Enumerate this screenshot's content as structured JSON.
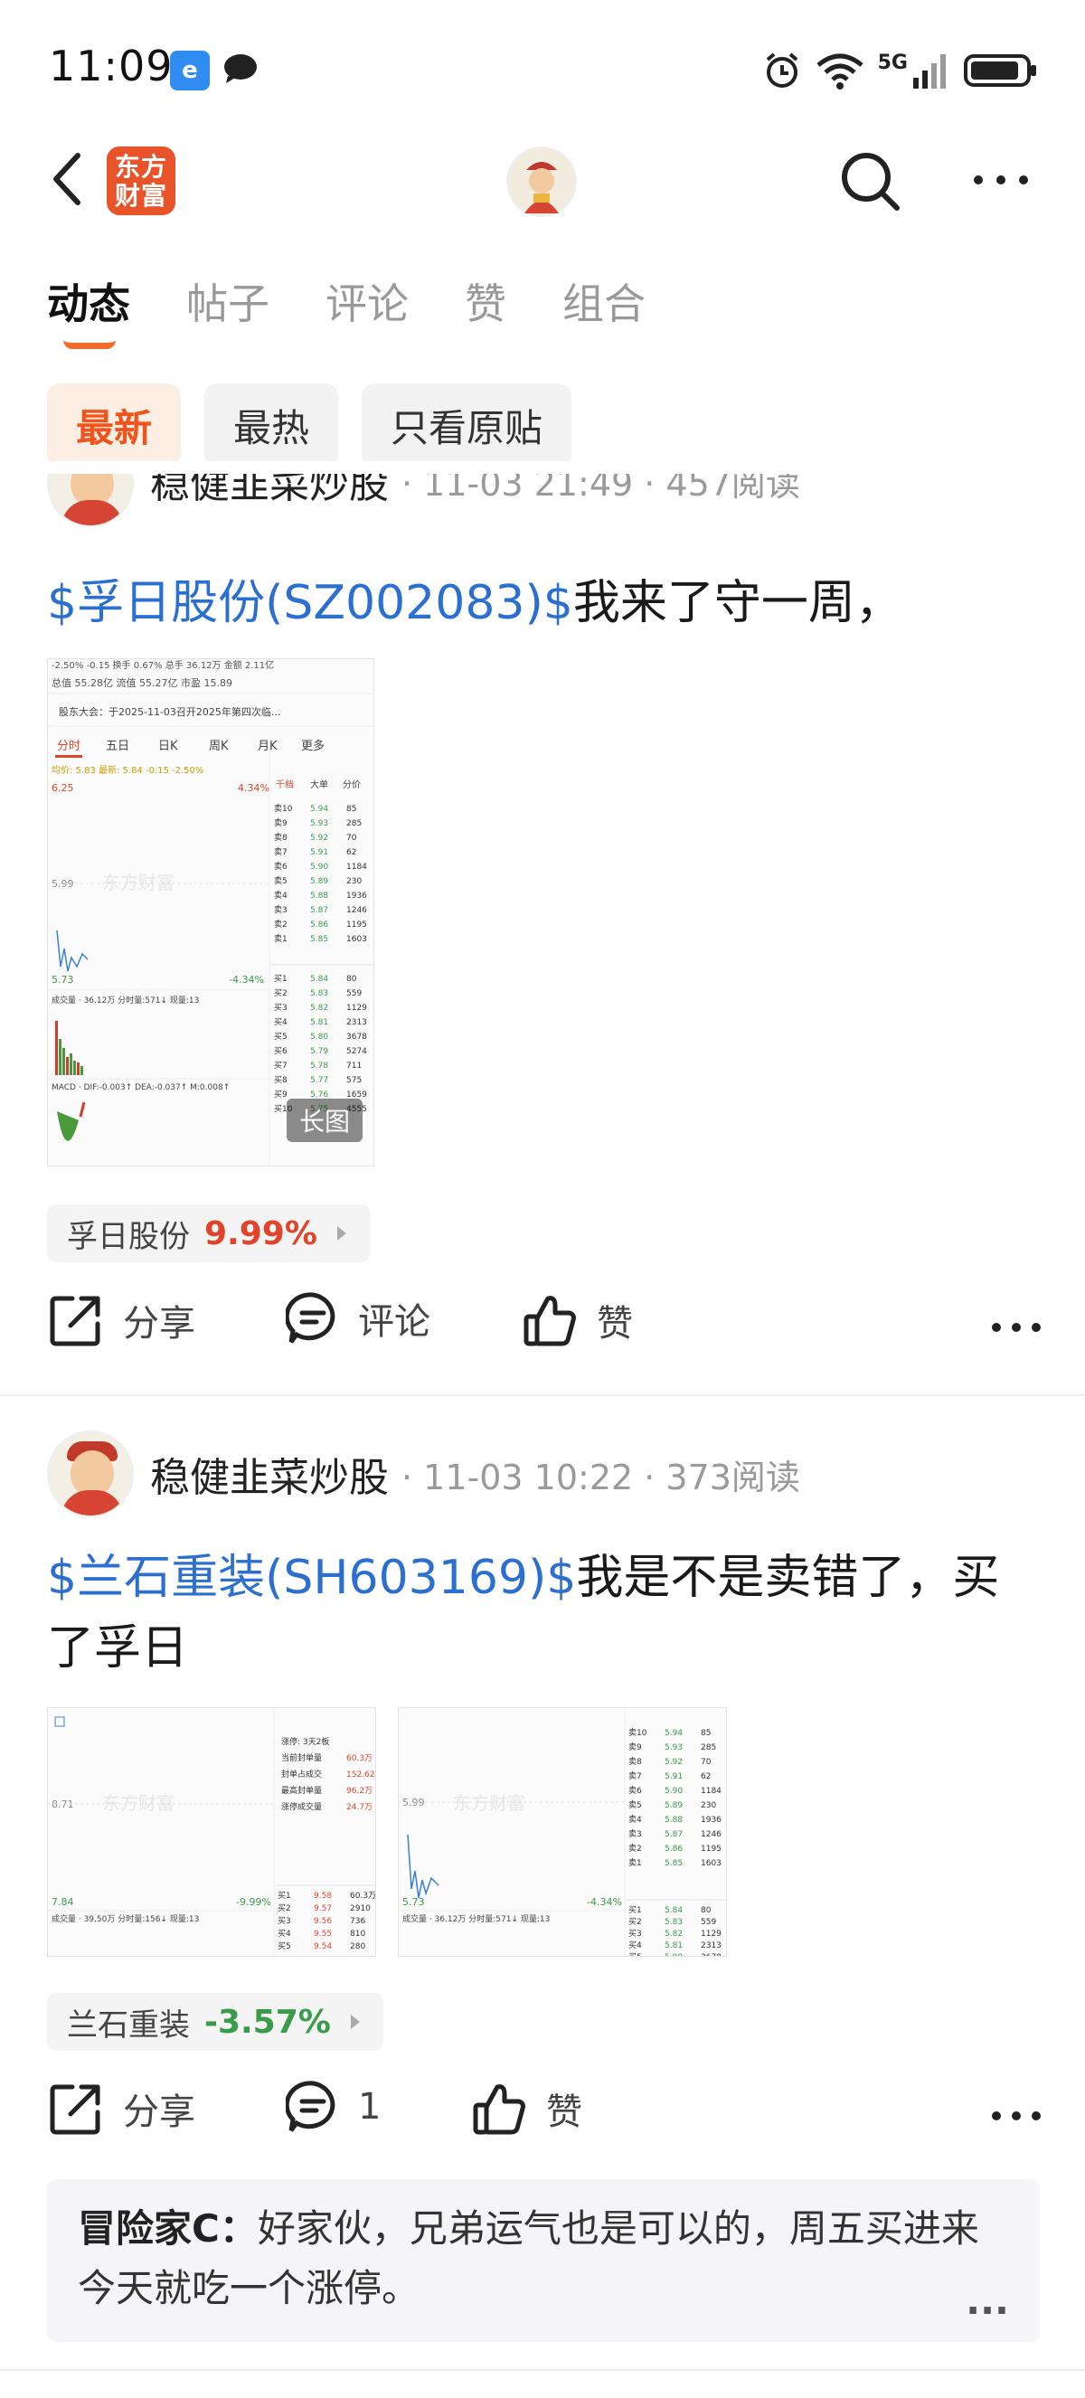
{
  "status_bar": {
    "time": "11:09",
    "network": "5G"
  },
  "header": {
    "logo_text": "东方财富"
  },
  "tabs": [
    {
      "label": "动态"
    },
    {
      "label": "帖子"
    },
    {
      "label": "评论"
    },
    {
      "label": "赞"
    },
    {
      "label": "组合"
    }
  ],
  "filters": [
    {
      "label": "最新"
    },
    {
      "label": "最热"
    },
    {
      "label": "只看原贴"
    }
  ],
  "posts": [
    {
      "username": "稳健韭菜炒股",
      "meta": "· 11-03 21:49 · 457阅读",
      "stock_link": "$孚日股份(SZ002083)$",
      "text": "我来了守一周，",
      "image_badge": "长图",
      "tag_name": "孚日股份",
      "tag_pct": "9.99%",
      "tag_color": "#e0452b",
      "share": "分享",
      "comment": "评论",
      "like": "赞"
    },
    {
      "username": "稳健韭菜炒股",
      "meta": "· 11-03 10:22 · 373阅读",
      "stock_link": "$兰石重装(SH603169)$",
      "text": "我是不是卖错了，买了孚日",
      "tag_name": "兰石重装",
      "tag_pct": "-3.57%",
      "tag_color": "#3a9b4a",
      "share": "分享",
      "comment": "1",
      "like": "赞"
    }
  ],
  "comment": {
    "author": "冒险家C：",
    "text": "好家伙，兄弟运气也是可以的，周五买进来今天就吃一个涨停。",
    "more": "..."
  },
  "chart1": {
    "top_row": "-2.50%  -0.15  换手 0.67%  总手 36.12万  金额 2.11亿",
    "row2": "总值 55.28亿   流值 55.27亿   市盈 15.89",
    "notice": "股东大会：于2025-11-03召开2025年第四次临...",
    "tabs": [
      "分时",
      "五日",
      "日K",
      "周K",
      "月K",
      "更多"
    ],
    "avg_line": "均价: 5.83  最新: 5.84  -0.15  -2.50%",
    "price_hi": "6.25",
    "pct_hi": "4.34%",
    "price_mid": "5.99",
    "price_lo": "5.73",
    "pct_lo": "-4.34%",
    "vol": "成交量 · 36.12万    分时量:571↓    现量:13",
    "macd": "MACD · DIF:-0.003↑  DEA:-0.037↑  M:0.008↑",
    "tabs_right": [
      "千档",
      "大单",
      "分价"
    ],
    "sells": [
      [
        "卖10",
        "5.94",
        "85"
      ],
      [
        "卖9",
        "5.93",
        "285"
      ],
      [
        "卖8",
        "5.92",
        "70"
      ],
      [
        "卖7",
        "5.91",
        "62"
      ],
      [
        "卖6",
        "5.90",
        "1184"
      ],
      [
        "卖5",
        "5.89",
        "230"
      ],
      [
        "卖4",
        "5.88",
        "1936"
      ],
      [
        "卖3",
        "5.87",
        "1246"
      ],
      [
        "卖2",
        "5.86",
        "1195"
      ],
      [
        "卖1",
        "5.85",
        "1603"
      ]
    ],
    "buys": [
      [
        "买1",
        "5.84",
        "80"
      ],
      [
        "买2",
        "5.83",
        "559"
      ],
      [
        "买3",
        "5.82",
        "1129"
      ],
      [
        "买4",
        "5.81",
        "2313"
      ],
      [
        "买5",
        "5.80",
        "3678"
      ],
      [
        "买6",
        "5.79",
        "5274"
      ],
      [
        "买7",
        "5.78",
        "711"
      ],
      [
        "买8",
        "5.77",
        "575"
      ],
      [
        "买9",
        "5.76",
        "1659"
      ],
      [
        "买10",
        "5.75",
        "4555"
      ]
    ],
    "watermark": "东方财富"
  },
  "chart2a": {
    "mid": "8.71",
    "lo": "7.84",
    "pct_lo": "-9.99%",
    "vol": "成交量 · 39.50万   分时量:156↓   现量:13",
    "panel": [
      [
        "涨停: 3天2板",
        ""
      ],
      [
        "当前封单量",
        "60.3万"
      ],
      [
        "封单占成交",
        "152.62%"
      ],
      [
        "最高封单量",
        "96.2万"
      ],
      [
        "涨停成交量",
        "24.7万"
      ]
    ],
    "buys": [
      [
        "买1",
        "9.58",
        "60.3万"
      ],
      [
        "买2",
        "9.57",
        "2910"
      ],
      [
        "买3",
        "9.56",
        "736"
      ],
      [
        "买4",
        "9.55",
        "810"
      ],
      [
        "买5",
        "9.54",
        "280"
      ]
    ]
  },
  "chart2b": {
    "mid": "5.99",
    "lo": "5.73",
    "pct_lo": "-4.34%",
    "vol": "成交量 · 36.12万   分时量:571↓   现量:13"
  }
}
